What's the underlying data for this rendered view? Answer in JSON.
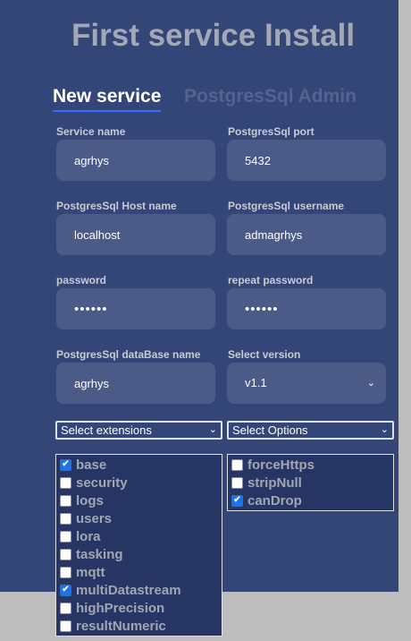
{
  "page": {
    "title": "First service Install"
  },
  "tabs": {
    "new_service": "New service",
    "postgres_admin": "PostgresSql Admin"
  },
  "form": {
    "service_name": {
      "label": "Service name",
      "value": "agrhys"
    },
    "pg_port": {
      "label": "PostgresSql port",
      "value": "5432"
    },
    "pg_host": {
      "label": "PostgresSql Host name",
      "value": "localhost"
    },
    "pg_user": {
      "label": "PostgresSql username",
      "value": "admagrhys"
    },
    "password": {
      "label": "password",
      "value": "••••••"
    },
    "repeat_password": {
      "label": "repeat password",
      "value": "••••••"
    },
    "pg_db": {
      "label": "PostgresSql dataBase name",
      "value": "agrhys"
    },
    "version": {
      "label": "Select version",
      "value": "v1.1"
    }
  },
  "extensions": {
    "select_label": "Select extensions",
    "items": [
      {
        "label": "base",
        "checked": true
      },
      {
        "label": "security",
        "checked": false
      },
      {
        "label": "logs",
        "checked": false
      },
      {
        "label": "users",
        "checked": false
      },
      {
        "label": "lora",
        "checked": false
      },
      {
        "label": "tasking",
        "checked": false
      },
      {
        "label": "mqtt",
        "checked": false
      },
      {
        "label": "multiDatastream",
        "checked": true
      },
      {
        "label": "highPrecision",
        "checked": false
      },
      {
        "label": "resultNumeric",
        "checked": false
      }
    ]
  },
  "options": {
    "select_label": "Select Options",
    "items": [
      {
        "label": "forceHttps",
        "checked": false
      },
      {
        "label": "stripNull",
        "checked": false
      },
      {
        "label": "canDrop",
        "checked": true
      }
    ]
  },
  "icons": {
    "chevron": "chevron-down-icon",
    "check": "checkmark-icon"
  }
}
